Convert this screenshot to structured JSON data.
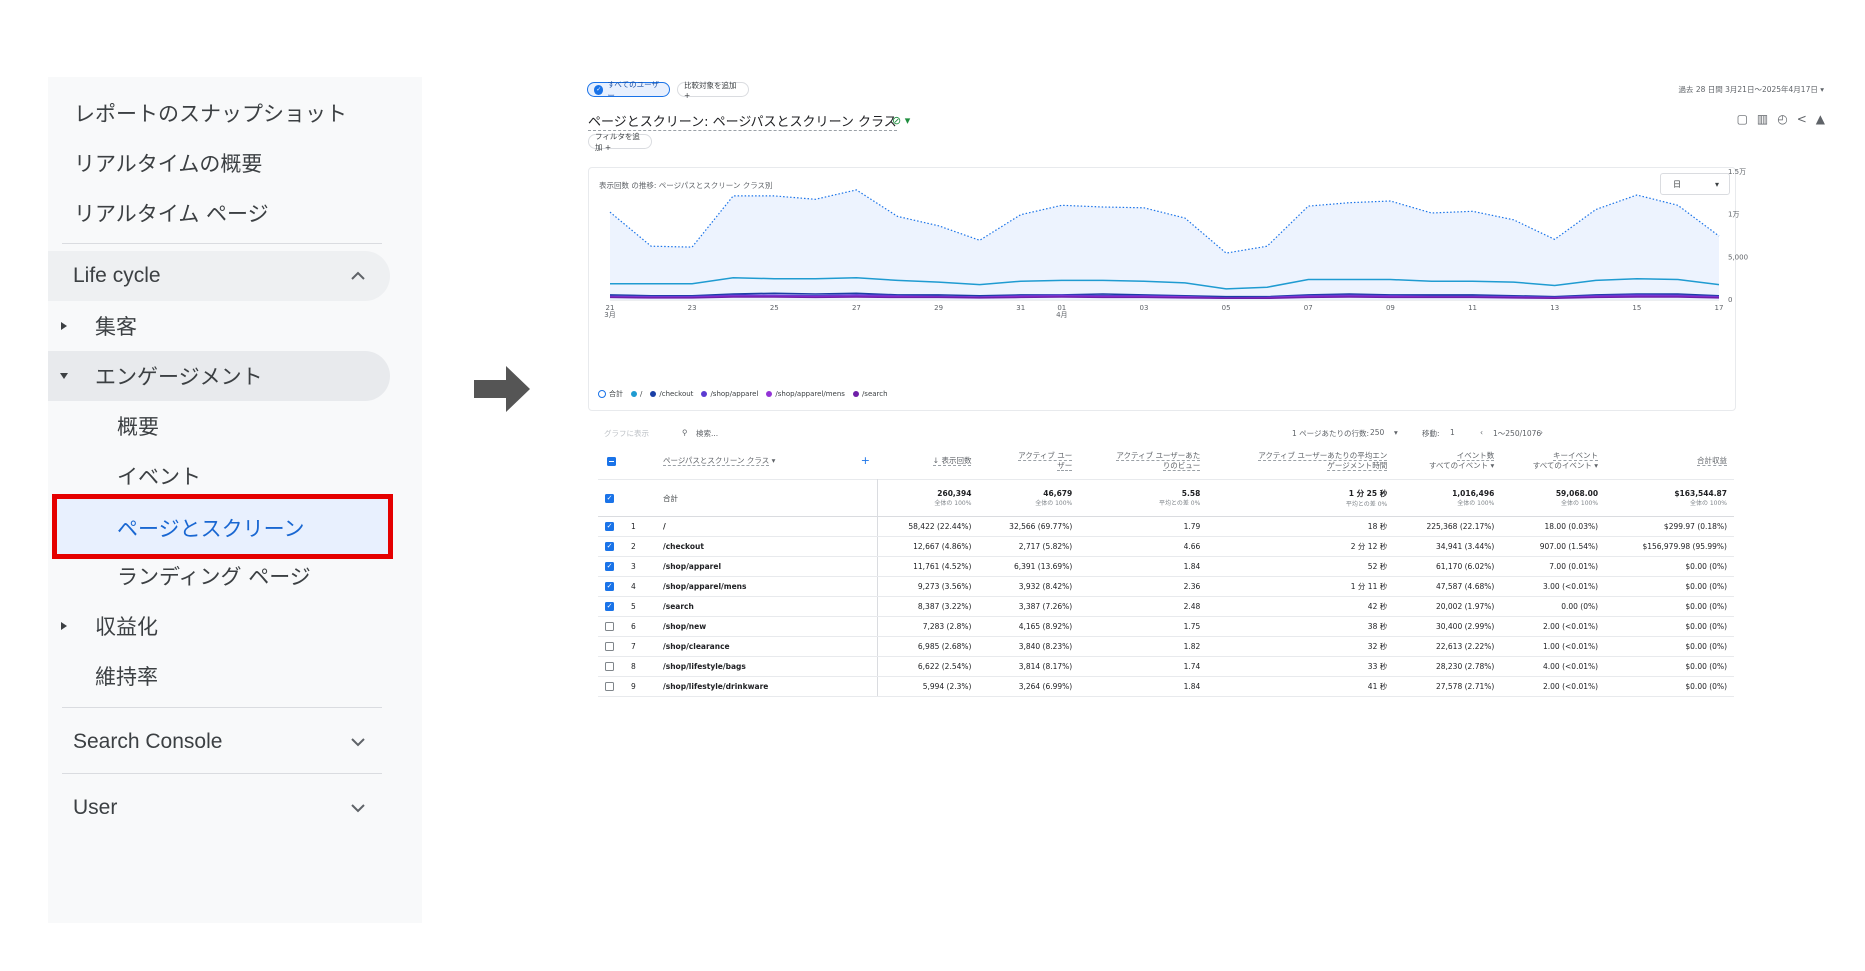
{
  "left_nav": {
    "top_items": [
      "レポートのスナップショット",
      "リアルタイムの概要",
      "リアルタイム ページ"
    ],
    "lifecycle_label": "Life cycle",
    "acquisition_label": "集客",
    "engagement_label": "エンゲージメント",
    "engagement_items": [
      "概要",
      "イベント"
    ],
    "selected_item": "ページとスクリーン",
    "landing_page_label": "ランディング ページ",
    "monetization_label": "収益化",
    "retention_label": "維持率",
    "search_console_label": "Search Console",
    "user_label": "User",
    "highlight_color": "#e50000"
  },
  "ga": {
    "chip_all_users": "すべてのユーザー",
    "chip_compare": "比較対象を追加 +",
    "chip_filter": "フィルタを追加 +",
    "date_range": "過去 28 日間  3月21日～2025年4月17日  ▾",
    "report_title": "ページとスクリーン: ページパスとスクリーン クラス",
    "chart_title": "表示回数 の推移: ページパスとスクリーン クラス別",
    "granularity": "日",
    "table_controls": {
      "plot_rows": "グラフに表示",
      "search": "検索...",
      "rows_per_page_label": "1 ページあたりの行数:",
      "rows_per_page": "250",
      "go_to_label": "移動:",
      "go_to": "1",
      "page_range": "1～250/1076"
    },
    "table": {
      "dimension_header": "ページパスとスクリーン クラス",
      "headers": [
        {
          "l1": "↓ 表示回数",
          "l2": ""
        },
        {
          "l1": "アクティブ ユー",
          "l2": "ザー"
        },
        {
          "l1": "アクティブ ユーザーあた",
          "l2": "りのビュー"
        },
        {
          "l1": "アクティブ ユーザーあたりの平均エン",
          "l2": "ゲージメント時間"
        },
        {
          "l1": "イベント数",
          "l2": "すべてのイベント ▾"
        },
        {
          "l1": "キーイベント",
          "l2": "すべてのイベント ▾"
        },
        {
          "l1": "合計収益",
          "l2": ""
        }
      ],
      "totals_label": "合計",
      "totals": [
        {
          "v": "260,394",
          "s": "全体の 100%"
        },
        {
          "v": "46,679",
          "s": "全体の 100%"
        },
        {
          "v": "5.58",
          "s": "平均との差 0%"
        },
        {
          "v": "1 分 25 秒",
          "s": "平均との差 0%"
        },
        {
          "v": "1,016,496",
          "s": "全体の 100%"
        },
        {
          "v": "59,068.00",
          "s": "全体の 100%"
        },
        {
          "v": "$163,544.87",
          "s": "全体の 100%"
        }
      ],
      "rows": [
        {
          "n": "1",
          "page": "/",
          "views": "58,422 (22.44%)",
          "users": "32,566 (69.77%)",
          "vpu": "1.79",
          "time": "18 秒",
          "events": "225,368 (22.17%)",
          "key": "18.00 (0.03%)",
          "rev": "$299.97 (0.18%)"
        },
        {
          "n": "2",
          "page": "/checkout",
          "views": "12,667 (4.86%)",
          "users": "2,717 (5.82%)",
          "vpu": "4.66",
          "time": "2 分 12 秒",
          "events": "34,941 (3.44%)",
          "key": "907.00 (1.54%)",
          "rev": "$156,979.98 (95.99%)"
        },
        {
          "n": "3",
          "page": "/shop/apparel",
          "views": "11,761 (4.52%)",
          "users": "6,391 (13.69%)",
          "vpu": "1.84",
          "time": "52 秒",
          "events": "61,170 (6.02%)",
          "key": "7.00 (0.01%)",
          "rev": "$0.00 (0%)"
        },
        {
          "n": "4",
          "page": "/shop/apparel/mens",
          "views": "9,273 (3.56%)",
          "users": "3,932 (8.42%)",
          "vpu": "2.36",
          "time": "1 分 11 秒",
          "events": "47,587 (4.68%)",
          "key": "3.00 (<0.01%)",
          "rev": "$0.00 (0%)"
        },
        {
          "n": "5",
          "page": "/search",
          "views": "8,387 (3.22%)",
          "users": "3,387 (7.26%)",
          "vpu": "2.48",
          "time": "42 秒",
          "events": "20,002 (1.97%)",
          "key": "0.00 (0%)",
          "rev": "$0.00 (0%)"
        },
        {
          "n": "6",
          "page": "/shop/new",
          "views": "7,283 (2.8%)",
          "users": "4,165 (8.92%)",
          "vpu": "1.75",
          "time": "38 秒",
          "events": "30,400 (2.99%)",
          "key": "2.00 (<0.01%)",
          "rev": "$0.00 (0%)"
        },
        {
          "n": "7",
          "page": "/shop/clearance",
          "views": "6,985 (2.68%)",
          "users": "3,840 (8.23%)",
          "vpu": "1.82",
          "time": "32 秒",
          "events": "22,613 (2.22%)",
          "key": "1.00 (<0.01%)",
          "rev": "$0.00 (0%)"
        },
        {
          "n": "8",
          "page": "/shop/lifestyle/bags",
          "views": "6,622 (2.54%)",
          "users": "3,814 (8.17%)",
          "vpu": "1.74",
          "time": "33 秒",
          "events": "28,230 (2.78%)",
          "key": "4.00 (<0.01%)",
          "rev": "$0.00 (0%)"
        },
        {
          "n": "9",
          "page": "/shop/lifestyle/drinkware",
          "views": "5,994 (2.3%)",
          "users": "3,264 (6.99%)",
          "vpu": "1.84",
          "time": "41 秒",
          "events": "27,578 (2.71%)",
          "key": "2.00 (<0.01%)",
          "rev": "$0.00 (0%)"
        }
      ],
      "checked": [
        true,
        true,
        true,
        true,
        true,
        false,
        false,
        false,
        false
      ]
    }
  },
  "chart_data": {
    "type": "line",
    "title": "表示回数 の推移: ページパスとスクリーン クラス別",
    "x": [
      "21",
      "22",
      "23",
      "24",
      "25",
      "26",
      "27",
      "28",
      "29",
      "30",
      "31",
      "01",
      "02",
      "03",
      "04",
      "05",
      "06",
      "07",
      "08",
      "09",
      "10",
      "11",
      "12",
      "13",
      "14",
      "15",
      "16",
      "17"
    ],
    "x_tick_labels": [
      "21",
      "23",
      "25",
      "27",
      "29",
      "31",
      "01",
      "03",
      "05",
      "07",
      "09",
      "11",
      "13",
      "15",
      "17"
    ],
    "x_month_labels": {
      "21": "3月",
      "01": "4月"
    },
    "y_ticks": [
      "0",
      "5,000",
      "1万",
      "1.5万"
    ],
    "ylim": [
      0,
      15000
    ],
    "series": [
      {
        "name": "合計",
        "color": "#1a73e8",
        "style": "dotted-area",
        "values": [
          10300,
          6300,
          6200,
          12200,
          12200,
          11800,
          12900,
          9800,
          8700,
          7000,
          10000,
          11100,
          10900,
          10800,
          9600,
          5500,
          6300,
          11000,
          11400,
          11600,
          10200,
          10400,
          9400,
          7100,
          10600,
          12300,
          11100,
          7500
        ]
      },
      {
        "name": "/",
        "color": "#1f9bd1",
        "values": [
          1900,
          1900,
          1900,
          2600,
          2500,
          2500,
          2600,
          2300,
          2100,
          1800,
          2200,
          2300,
          2300,
          2200,
          2000,
          1300,
          1500,
          2400,
          2400,
          2400,
          2200,
          2200,
          2100,
          1700,
          2300,
          2500,
          2400,
          1800
        ]
      },
      {
        "name": "/checkout",
        "color": "#1a3fa6",
        "values": [
          600,
          500,
          500,
          700,
          800,
          700,
          800,
          600,
          600,
          500,
          600,
          600,
          700,
          600,
          500,
          400,
          400,
          600,
          700,
          600,
          600,
          600,
          500,
          400,
          600,
          700,
          700,
          500
        ]
      },
      {
        "name": "/shop/apparel",
        "color": "#5b3bd1",
        "values": [
          450,
          400,
          400,
          550,
          550,
          500,
          600,
          500,
          450,
          350,
          500,
          550,
          500,
          500,
          400,
          250,
          300,
          500,
          550,
          500,
          450,
          450,
          400,
          300,
          500,
          600,
          550,
          400
        ]
      },
      {
        "name": "/shop/apparel/mens",
        "color": "#9333d6",
        "values": [
          350,
          300,
          300,
          450,
          450,
          400,
          450,
          400,
          350,
          300,
          400,
          450,
          400,
          400,
          350,
          200,
          250,
          400,
          450,
          400,
          350,
          350,
          300,
          250,
          400,
          450,
          450,
          300
        ]
      },
      {
        "name": "/search",
        "color": "#6f1fa8",
        "values": [
          300,
          250,
          250,
          350,
          350,
          300,
          350,
          300,
          300,
          250,
          300,
          350,
          300,
          300,
          250,
          200,
          200,
          300,
          350,
          300,
          300,
          300,
          250,
          200,
          300,
          350,
          350,
          250
        ]
      }
    ],
    "legend": "bottom-left"
  }
}
